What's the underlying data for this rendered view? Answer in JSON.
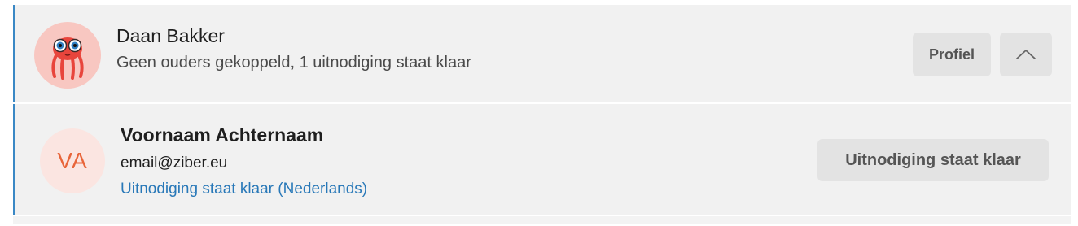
{
  "student": {
    "name": "Daan Bakker",
    "status": "Geen ouders gekoppeld, 1 uitnodiging staat klaar",
    "avatar_icon": "octopus-mascot-icon",
    "profile_button": "Profiel",
    "collapse_icon": "chevron-up-icon"
  },
  "parent": {
    "initials": "VA",
    "name": "Voornaam Achternaam",
    "email": "email@ziber.eu",
    "invite_status": "Uitnodiging staat klaar (Nederlands)",
    "invite_button": "Uitnodiging staat klaar"
  },
  "colors": {
    "accent_border": "#3a88c5",
    "link": "#2878b8",
    "initials": "#e8653a",
    "mascot_bg": "#f8c7c1"
  }
}
